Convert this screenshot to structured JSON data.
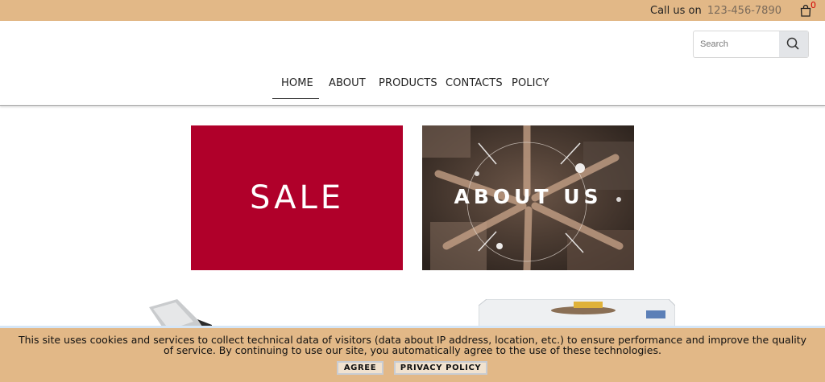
{
  "topbar": {
    "call_label": "Call us on",
    "phone": "123-456-7890",
    "cart_count": "0"
  },
  "search": {
    "placeholder": "Search"
  },
  "nav": {
    "items": [
      {
        "label": "HOME",
        "active": true
      },
      {
        "label": "ABOUT"
      },
      {
        "label": "PRODUCTS"
      },
      {
        "label": "CONTACTS"
      },
      {
        "label": "POLICY"
      }
    ]
  },
  "banners": {
    "sale": "SALE",
    "about": "ABOUT US"
  },
  "cookie": {
    "message": "This site uses cookies and services to collect technical data of visitors (data about IP address, location, etc.) to ensure performance and improve the quality of service. By continuing to use our site, you automatically agree to the use of these technologies.",
    "agree": "AGREE",
    "policy": "PRIVACY POLICY"
  },
  "colors": {
    "topbar": "#e2b887",
    "sale": "#b0002a",
    "cart_badge": "#d40000"
  }
}
